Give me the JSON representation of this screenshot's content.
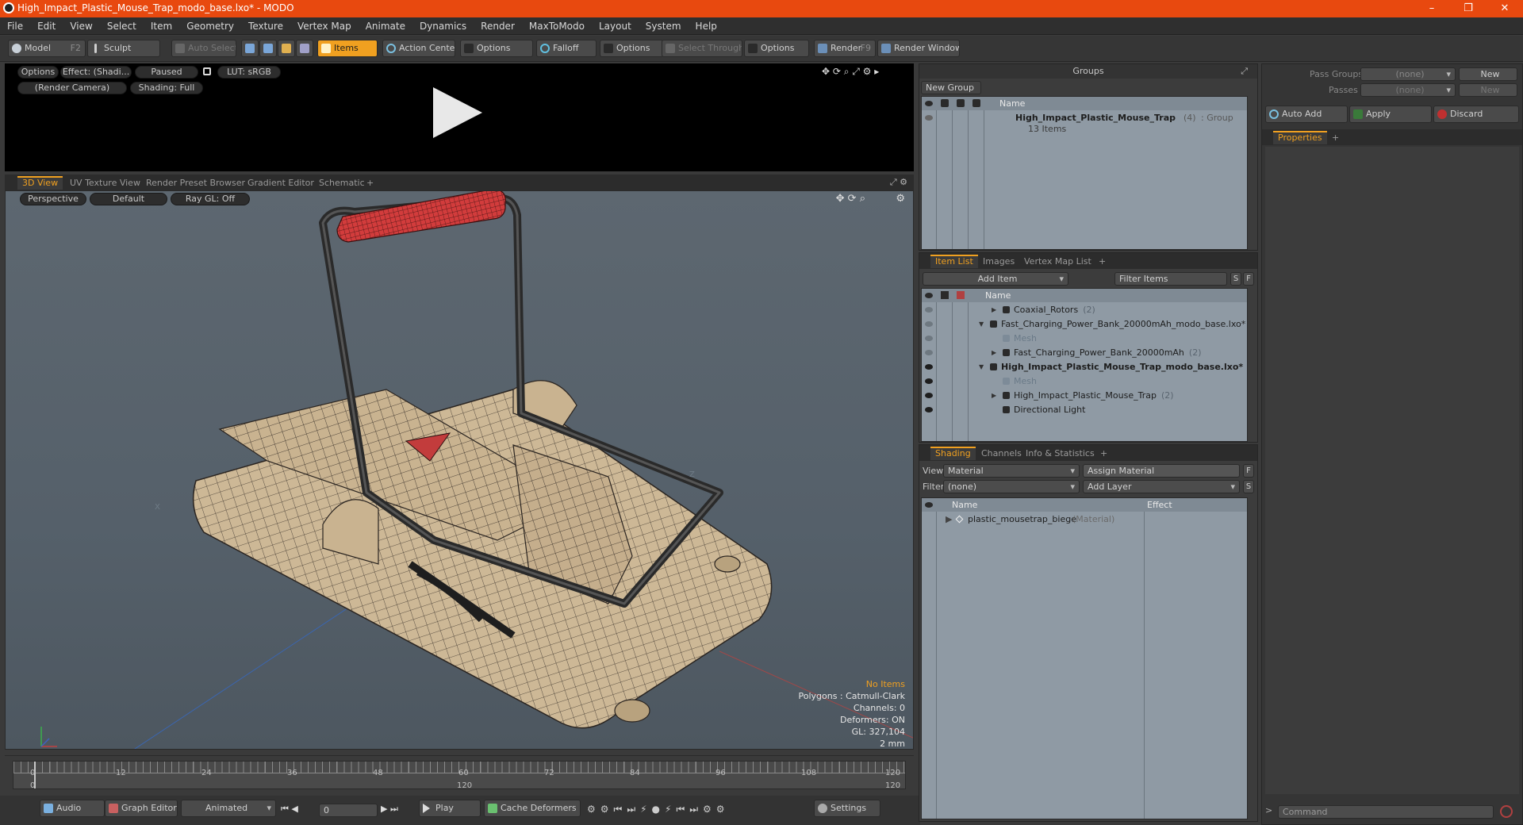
{
  "window": {
    "title": "High_Impact_Plastic_Mouse_Trap_modo_base.lxo* - MODO",
    "minimize": "–",
    "maximize": "❐",
    "close": "✕"
  },
  "menu": [
    "File",
    "Edit",
    "View",
    "Select",
    "Item",
    "Geometry",
    "Texture",
    "Vertex Map",
    "Animate",
    "Dynamics",
    "Render",
    "MaxToModo",
    "Layout",
    "System",
    "Help"
  ],
  "toolbar": {
    "model": "Model",
    "model_key": "F2",
    "sculpt": "Sculpt",
    "auto_select": "Auto Select",
    "items": "Items",
    "action_center": "Action Center",
    "options1": "Options",
    "falloff": "Falloff",
    "options2": "Options",
    "select_through": "Select Through",
    "options3": "Options",
    "render": "Render",
    "render_key": "F9",
    "render_window": "Render Window"
  },
  "preview": {
    "options": "Options",
    "effect": "Effect: (Shadi...",
    "paused": "Paused",
    "lut": "LUT: sRGB",
    "camera": "(Render Camera)",
    "shading": "Shading: Full"
  },
  "view_tabs": [
    "3D View",
    "UV Texture View",
    "Render Preset Browser",
    "Gradient Editor",
    "Schematic",
    "+"
  ],
  "viewport": {
    "perspective": "Perspective",
    "default": "Default",
    "raygl": "Ray GL: Off",
    "axis_x": "X",
    "axis_z": "Z",
    "stats": {
      "no_items": "No Items",
      "polygons": "Polygons : Catmull-Clark",
      "channels": "Channels: 0",
      "deformers": "Deformers: ON",
      "gl": "GL: 327,104",
      "unit": "2 mm"
    }
  },
  "timeline": {
    "ticks": [
      "0",
      "12",
      "24",
      "36",
      "48",
      "60",
      "72",
      "84",
      "96",
      "108",
      "120"
    ],
    "start": "0",
    "mid": "120",
    "end": "120"
  },
  "transport": {
    "audio": "Audio",
    "graph_editor": "Graph Editor",
    "animated": "Animated",
    "frame": "0",
    "play": "Play",
    "cache": "Cache Deformers",
    "settings": "Settings"
  },
  "groups": {
    "title": "Groups",
    "new_group": "New Group",
    "col_name": "Name",
    "row_name": "High_Impact_Plastic_Mouse_Trap",
    "row_count": "(4)",
    "row_type": ": Group",
    "row_sub": "13 Items"
  },
  "pass": {
    "pass_groups": "Pass Groups",
    "passes": "Passes",
    "none1": "(none)",
    "none2": "(none)",
    "new1": "New",
    "new2": "New"
  },
  "actions": {
    "auto_add": "Auto Add",
    "apply": "Apply",
    "discard": "Discard"
  },
  "properties": {
    "tab": "Properties",
    "plus": "+"
  },
  "itemlist": {
    "tabs": [
      "Item List",
      "Images",
      "Vertex Map List",
      "+"
    ],
    "add_item": "Add Item",
    "filter": "Filter Items",
    "s": "S",
    "f": "F",
    "col_name": "Name",
    "rows": [
      {
        "text": "Coaxial_Rotors",
        "extra": "(2)",
        "indent": 1,
        "arrow": "▶",
        "bold": false,
        "gray": false,
        "eye": false
      },
      {
        "text": "Fast_Charging_Power_Bank_20000mAh_modo_base.lxo*",
        "extra": "",
        "indent": 0,
        "arrow": "▼",
        "bold": false,
        "gray": false,
        "eye": false
      },
      {
        "text": "Mesh",
        "extra": "",
        "indent": 1,
        "arrow": "",
        "bold": false,
        "gray": true,
        "eye": false
      },
      {
        "text": "Fast_Charging_Power_Bank_20000mAh",
        "extra": "(2)",
        "indent": 1,
        "arrow": "▶",
        "bold": false,
        "gray": false,
        "eye": false
      },
      {
        "text": "High_Impact_Plastic_Mouse_Trap_modo_base.lxo*",
        "extra": "",
        "indent": 0,
        "arrow": "▼",
        "bold": true,
        "gray": false,
        "eye": true
      },
      {
        "text": "Mesh",
        "extra": "",
        "indent": 1,
        "arrow": "",
        "bold": false,
        "gray": true,
        "eye": true
      },
      {
        "text": "High_Impact_Plastic_Mouse_Trap",
        "extra": "(2)",
        "indent": 1,
        "arrow": "▶",
        "bold": false,
        "gray": false,
        "eye": true
      },
      {
        "text": "Directional Light",
        "extra": "",
        "indent": 1,
        "arrow": "",
        "bold": false,
        "gray": false,
        "eye": true
      }
    ]
  },
  "shading": {
    "tabs": [
      "Shading",
      "Channels",
      "Info & Statistics",
      "+"
    ],
    "view_label": "View",
    "view_value": "Material",
    "assign": "Assign Material",
    "f": "F",
    "filter_label": "Filter",
    "filter_value": "(none)",
    "add_layer": "Add Layer",
    "s": "S",
    "col_name": "Name",
    "col_effect": "Effect",
    "row_name": "plastic_mousetrap_biege",
    "row_type": "(Material)"
  },
  "command": {
    "placeholder": "Command"
  },
  "colors": {
    "accent": "#f0a020",
    "titlebar": "#e8490f",
    "handle": "#d23c3c",
    "trap": "#cdb896"
  }
}
